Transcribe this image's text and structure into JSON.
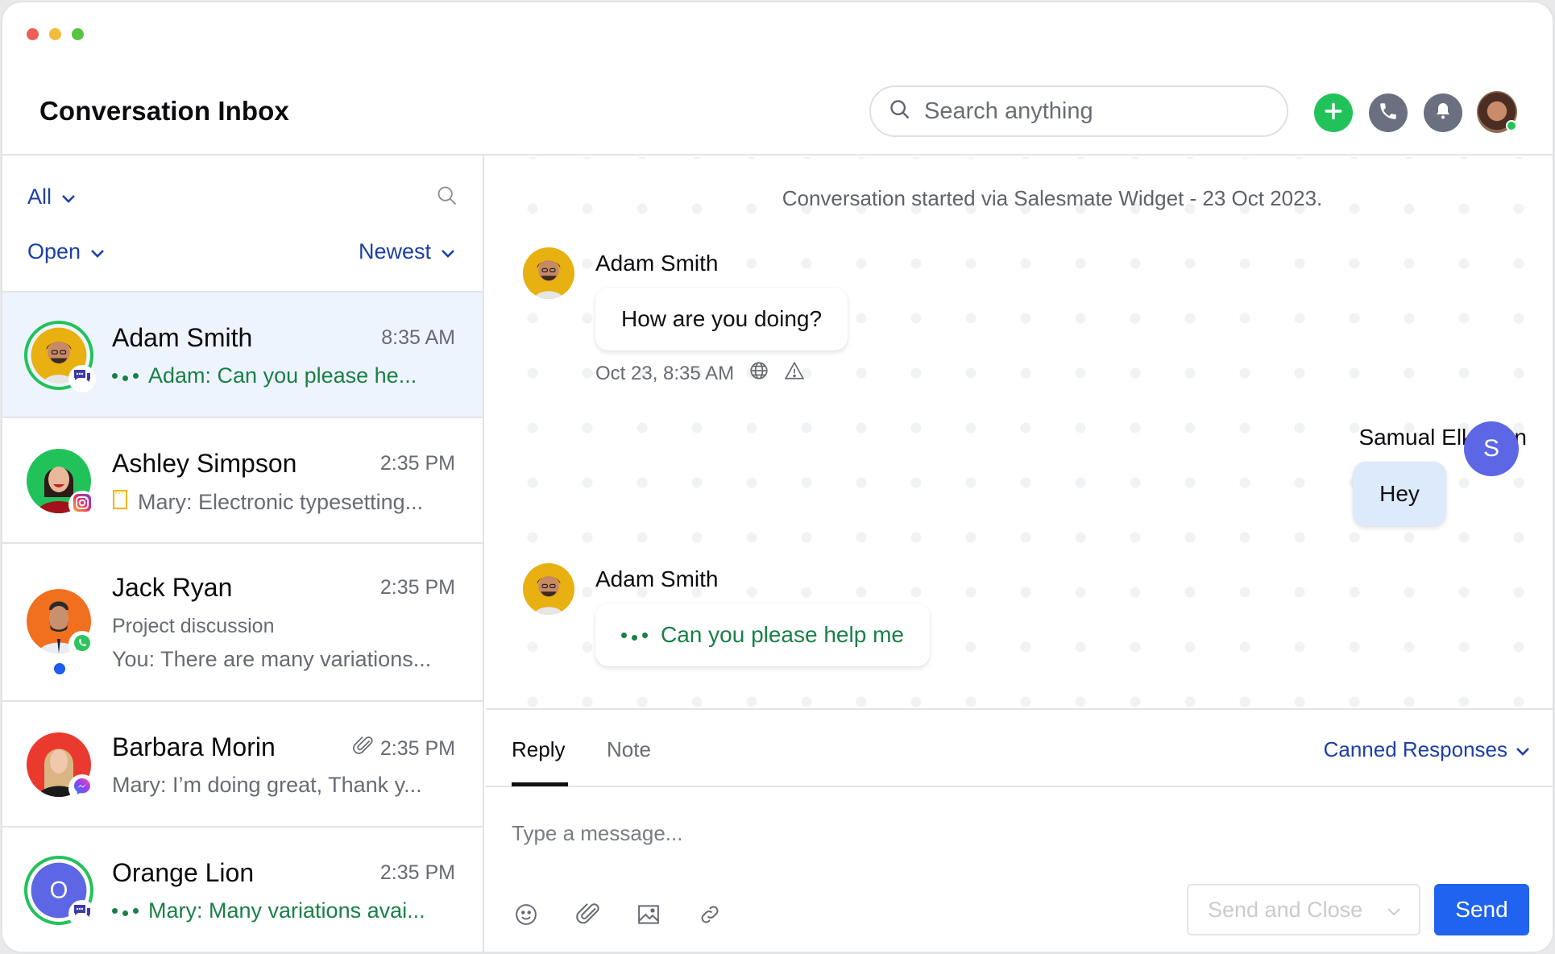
{
  "window": {
    "controls": [
      {
        "name": "close",
        "color": "#ec5f57"
      },
      {
        "name": "minimize",
        "color": "#f4bc3d"
      },
      {
        "name": "maximize",
        "color": "#58c443"
      }
    ]
  },
  "header": {
    "title": "Conversation Inbox",
    "search_placeholder": "Search anything",
    "actions": [
      {
        "icon": "plus-icon",
        "color": "#22c25a"
      },
      {
        "icon": "phone-icon",
        "color": "#6b7080"
      },
      {
        "icon": "bell-icon",
        "color": "#6b7080"
      }
    ],
    "user_status": "online"
  },
  "filters": {
    "scope": "All",
    "status": "Open",
    "sort": "Newest"
  },
  "conversations": [
    {
      "name": "Adam Smith",
      "time": "8:35 AM",
      "preview": "Adam: Can you please he...",
      "typing": true,
      "channel": "chat-icon",
      "active": true,
      "ring": true
    },
    {
      "name": "Ashley Simpson",
      "time": "2:35 PM",
      "preview": "Mary: Electronic typesetting...",
      "channel": "instagram-icon",
      "note": true
    },
    {
      "name": "Jack Ryan",
      "time": "2:35 PM",
      "subject": "Project discussion",
      "preview": "You: There are many variations...",
      "channel": "whatsapp-icon",
      "unread": true
    },
    {
      "name": "Barbara Morin",
      "time": "2:35 PM",
      "preview": "Mary: I’m doing great, Thank y...",
      "channel": "messenger-icon",
      "attachment": true
    },
    {
      "name": "Orange Lion",
      "initial": "O",
      "time": "2:35 PM",
      "preview": "Mary: Many variations avai...",
      "typing": true,
      "channel": "chat-icon",
      "ring": true
    }
  ],
  "chat": {
    "started_note": "Conversation started via Salesmate Widget - 23 Oct 2023.",
    "messages": [
      {
        "sender": "Adam Smith",
        "text": "How are you doing?",
        "meta": "Oct 23, 8:35 AM"
      },
      {
        "sender": "Samual Elkinson",
        "initial": "S",
        "text": "Hey"
      },
      {
        "sender": "Adam Smith",
        "text": "Can you please help me",
        "typing": true
      }
    ]
  },
  "composer": {
    "tabs": [
      "Reply",
      "Note"
    ],
    "active_tab": "Reply",
    "canned_label": "Canned Responses",
    "input_placeholder": "Type a message...",
    "input_value": "",
    "send_close_label": "Send and Close",
    "send_label": "Send",
    "accent": "#1f63f0"
  }
}
